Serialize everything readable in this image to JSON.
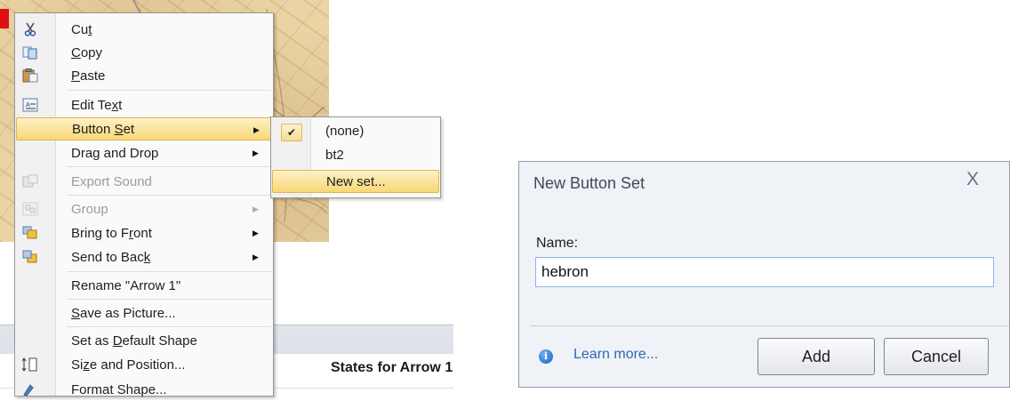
{
  "context_menu": {
    "items": [
      {
        "label_pre": "Cu",
        "label_ul": "t",
        "label_post": "",
        "icon": "scissors-icon",
        "disabled": false,
        "submenu": false
      },
      {
        "label_pre": "",
        "label_ul": "C",
        "label_post": "opy",
        "icon": "copy-icon",
        "disabled": false,
        "submenu": false
      },
      {
        "label_pre": "",
        "label_ul": "P",
        "label_post": "aste",
        "icon": "paste-icon",
        "disabled": false,
        "submenu": false
      },
      {
        "label_pre": "Edit Te",
        "label_ul": "x",
        "label_post": "t",
        "icon": "edit-text-icon",
        "disabled": false,
        "submenu": false
      },
      {
        "label_pre": "Button ",
        "label_ul": "S",
        "label_post": "et",
        "icon": "",
        "disabled": false,
        "submenu": true
      },
      {
        "label_pre": "Drag and Drop",
        "label_ul": "",
        "label_post": "",
        "icon": "",
        "disabled": false,
        "submenu": true
      },
      {
        "label_pre": "Export Sound",
        "label_ul": "",
        "label_post": "",
        "icon": "export-sound-icon",
        "disabled": true,
        "submenu": false
      },
      {
        "label_pre": "Group",
        "label_ul": "",
        "label_post": "",
        "icon": "group-icon",
        "disabled": true,
        "submenu": true
      },
      {
        "label_pre": "Bring to F",
        "label_ul": "r",
        "label_post": "ont",
        "icon": "bring-to-front-icon",
        "disabled": false,
        "submenu": true
      },
      {
        "label_pre": "Send to Bac",
        "label_ul": "k",
        "label_post": "",
        "icon": "send-to-back-icon",
        "disabled": false,
        "submenu": true
      },
      {
        "label_pre": "Rename \"Arrow 1\"",
        "label_ul": "",
        "label_post": "",
        "icon": "",
        "disabled": false,
        "submenu": false
      },
      {
        "label_pre": "",
        "label_ul": "S",
        "label_post": "ave as Picture...",
        "icon": "",
        "disabled": false,
        "submenu": false
      },
      {
        "label_pre": "Set as ",
        "label_ul": "D",
        "label_post": "efault Shape",
        "icon": "",
        "disabled": false,
        "submenu": false
      },
      {
        "label_pre": "Si",
        "label_ul": "z",
        "label_post": "e and Position...",
        "icon": "size-position-icon",
        "disabled": false,
        "submenu": false
      },
      {
        "label_pre": "Format Shape...",
        "label_ul": "",
        "label_post": "",
        "icon": "format-shape-icon",
        "disabled": false,
        "submenu": false
      }
    ]
  },
  "submenu": {
    "items": [
      "(none)",
      "bt2",
      "New set..."
    ],
    "checked": "(none)",
    "highlighted": "New set...",
    "check_glyph": "✔"
  },
  "ribbon": {
    "states_label": "States for Arrow 1"
  },
  "dialog": {
    "title": "New Button Set",
    "close_glyph": "X",
    "name_label": "Name:",
    "name_value": "hebron",
    "learn_more": "Learn more...",
    "info_glyph": "i",
    "add_label": "Add",
    "cancel_label": "Cancel"
  },
  "colors": {
    "menu_highlight": "#f8d777",
    "map_background": "#ead4a4",
    "link": "#2a68b7"
  }
}
